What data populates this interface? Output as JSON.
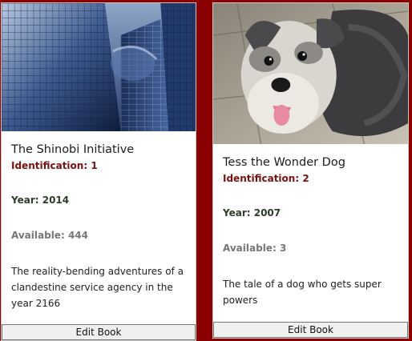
{
  "page": {
    "background_color": "#8b0000"
  },
  "books": [
    {
      "title": "The Shinobi Initiative",
      "identification_label": "Identification:",
      "identification_value": "1",
      "year_label": "Year:",
      "year_value": "2014",
      "available_label": "Available:",
      "available_value": "444",
      "description": "The reality-bending adventures of a clandestine service agency in the year 2166",
      "edit_label": "Edit Book",
      "image": "skyscraper-photo"
    },
    {
      "title": "Tess the Wonder Dog",
      "identification_label": "Identification:",
      "identification_value": "2",
      "year_label": "Year:",
      "year_value": "2007",
      "available_label": "Available:",
      "available_value": "3",
      "description": "The tale of a dog who gets super powers",
      "edit_label": "Edit Book",
      "image": "dog-photo"
    }
  ]
}
